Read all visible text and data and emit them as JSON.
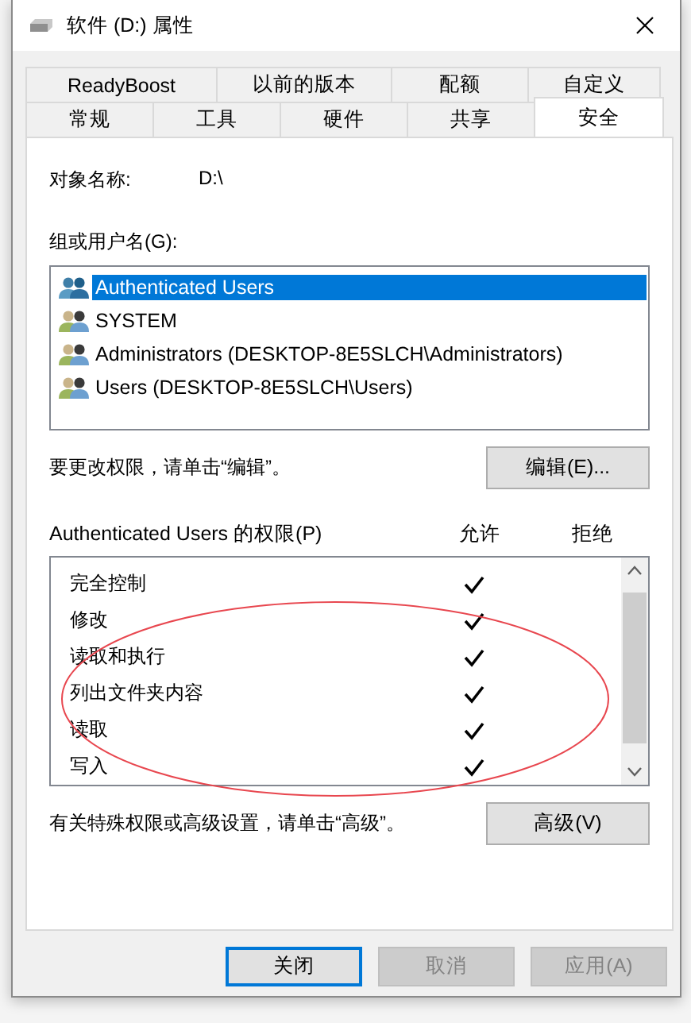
{
  "window": {
    "title": "软件 (D:) 属性"
  },
  "tabs": [
    [
      {
        "label": "ReadyBoost",
        "selected": false
      },
      {
        "label": "以前的版本",
        "selected": false
      },
      {
        "label": "配额",
        "selected": false
      },
      {
        "label": "自定义",
        "selected": false
      }
    ],
    [
      {
        "label": "常规",
        "selected": false
      },
      {
        "label": "工具",
        "selected": false
      },
      {
        "label": "硬件",
        "selected": false
      },
      {
        "label": "共享",
        "selected": false
      },
      {
        "label": "安全",
        "selected": true
      }
    ]
  ],
  "object_name": {
    "label": "对象名称:",
    "value": "D:\\"
  },
  "users_label": "组或用户名(G):",
  "users": [
    {
      "name": "Authenticated Users",
      "selected": true
    },
    {
      "name": "SYSTEM",
      "selected": false
    },
    {
      "name": "Administrators (DESKTOP-8E5SLCH\\Administrators)",
      "selected": false
    },
    {
      "name": "Users (DESKTOP-8E5SLCH\\Users)",
      "selected": false
    }
  ],
  "edit_note": "要更改权限，请单击“编辑”。",
  "edit_button": "编辑(E)...",
  "permissions_label": "Authenticated Users 的权限(P)",
  "columns": [
    "允许",
    "拒绝"
  ],
  "permissions": [
    {
      "name": "完全控制",
      "allow": true,
      "deny": false
    },
    {
      "name": "修改",
      "allow": true,
      "deny": false
    },
    {
      "name": "读取和执行",
      "allow": true,
      "deny": false
    },
    {
      "name": "列出文件夹内容",
      "allow": true,
      "deny": false
    },
    {
      "name": "读取",
      "allow": true,
      "deny": false
    },
    {
      "name": "写入",
      "allow": true,
      "deny": false
    }
  ],
  "advanced_note": "有关特殊权限或高级设置，请单击“高级”。",
  "advanced_button": "高级(V)",
  "annotation": {
    "kind": "ellipse",
    "color": "#e8474f"
  },
  "buttons": [
    {
      "label": "关闭",
      "default": true,
      "disabled": false
    },
    {
      "label": "取消",
      "default": false,
      "disabled": true
    },
    {
      "label": "应用(A)",
      "default": false,
      "disabled": true
    }
  ]
}
